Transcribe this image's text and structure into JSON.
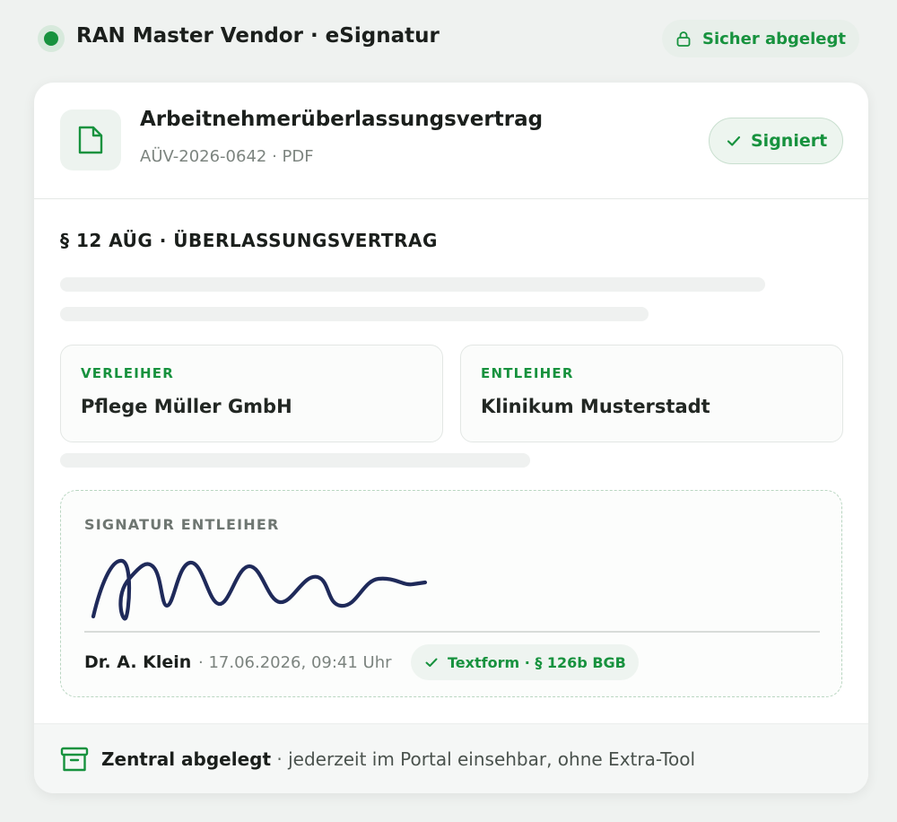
{
  "header": {
    "app_title": "RAN Master Vendor · eSignatur",
    "secure_label": "Sicher abgelegt",
    "status_color": "#17923e"
  },
  "document": {
    "title": "Arbeitnehmerüberlassungsvertrag",
    "subtitle": "AÜV-2026-0642 · PDF",
    "status_label": "Signiert",
    "icon": "document-icon"
  },
  "contract": {
    "section_title": "§ 12 AÜG · ÜBERLASSUNGSVERTRAG",
    "lender": {
      "label": "VERLEIHER",
      "name": "Pflege Müller GmbH"
    },
    "borrower": {
      "label": "ENTLEIHER",
      "name": "Klinikum Musterstadt"
    }
  },
  "signature": {
    "label": "SIGNATUR ENTLEIHER",
    "signer": "Dr. A. Klein",
    "timestamp": "· 17.06.2026, 09:41 Uhr",
    "form_label": "Textform · § 126b BGB",
    "ink_color": "#1f2a5a"
  },
  "footer": {
    "strong": "Zentral abgelegt",
    "separator": " · ",
    "rest": "jederzeit im Portal einsehbar, ohne Extra-Tool",
    "icon": "archive-icon"
  },
  "colors": {
    "accent": "#17923e",
    "background": "#eff2f0",
    "card": "#ffffff"
  }
}
